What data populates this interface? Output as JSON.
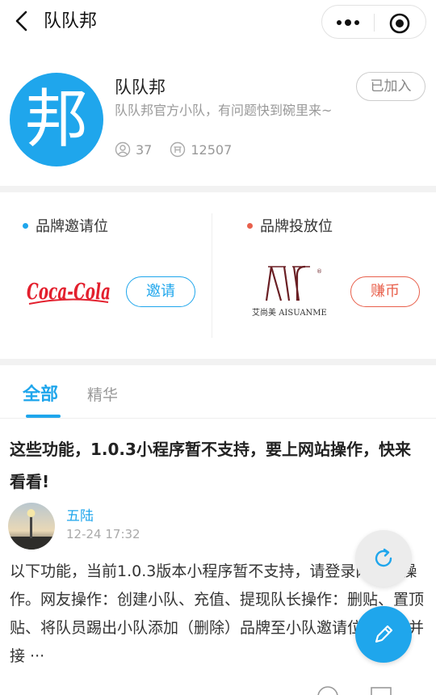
{
  "nav": {
    "title": "队队邦",
    "back_icon": "chevron-left-icon",
    "more_icon": "more-dots-icon",
    "close_icon": "target-circle-icon"
  },
  "team": {
    "logo_char": "邦",
    "name": "队队邦",
    "description": "队队邦官方小队，有问题快到碗里来~",
    "member_count": "37",
    "coin_count": "12507",
    "joined_label": "已加入",
    "logo_color": "#1fa6ec"
  },
  "brands": {
    "invite_title": "品牌邀请位",
    "invite_button": "邀请",
    "invite_logo_text": "Coca-Cola",
    "ad_title": "品牌投放位",
    "ad_button": "赚币",
    "ad_logo_text_cn": "艾尚美",
    "ad_logo_text_en": "AISUANME",
    "invite_dot_color": "#1fa6ec",
    "ad_dot_color": "#e8604c"
  },
  "tabs": [
    {
      "label": "全部",
      "active": true
    },
    {
      "label": "精华",
      "active": false
    }
  ],
  "post": {
    "title": "这些功能，1.0.3小程序暂不支持，要上网站操作，快来看看!",
    "author": "五陆",
    "time": "12-24 17:32",
    "body": "以下功能，当前1.0.3版本小程序暂不支持，请登录网站后操作。网友操作：创建小队、充值、提现队长操作：删贴、置顶贴、将队员踢出小队添加（删除）品牌至小队邀请位、查看并接 ···"
  },
  "fab": {
    "refresh_icon": "refresh-icon",
    "edit_icon": "pencil-icon"
  },
  "colors": {
    "accent": "#1fa6ec",
    "earn": "#e8604c"
  }
}
